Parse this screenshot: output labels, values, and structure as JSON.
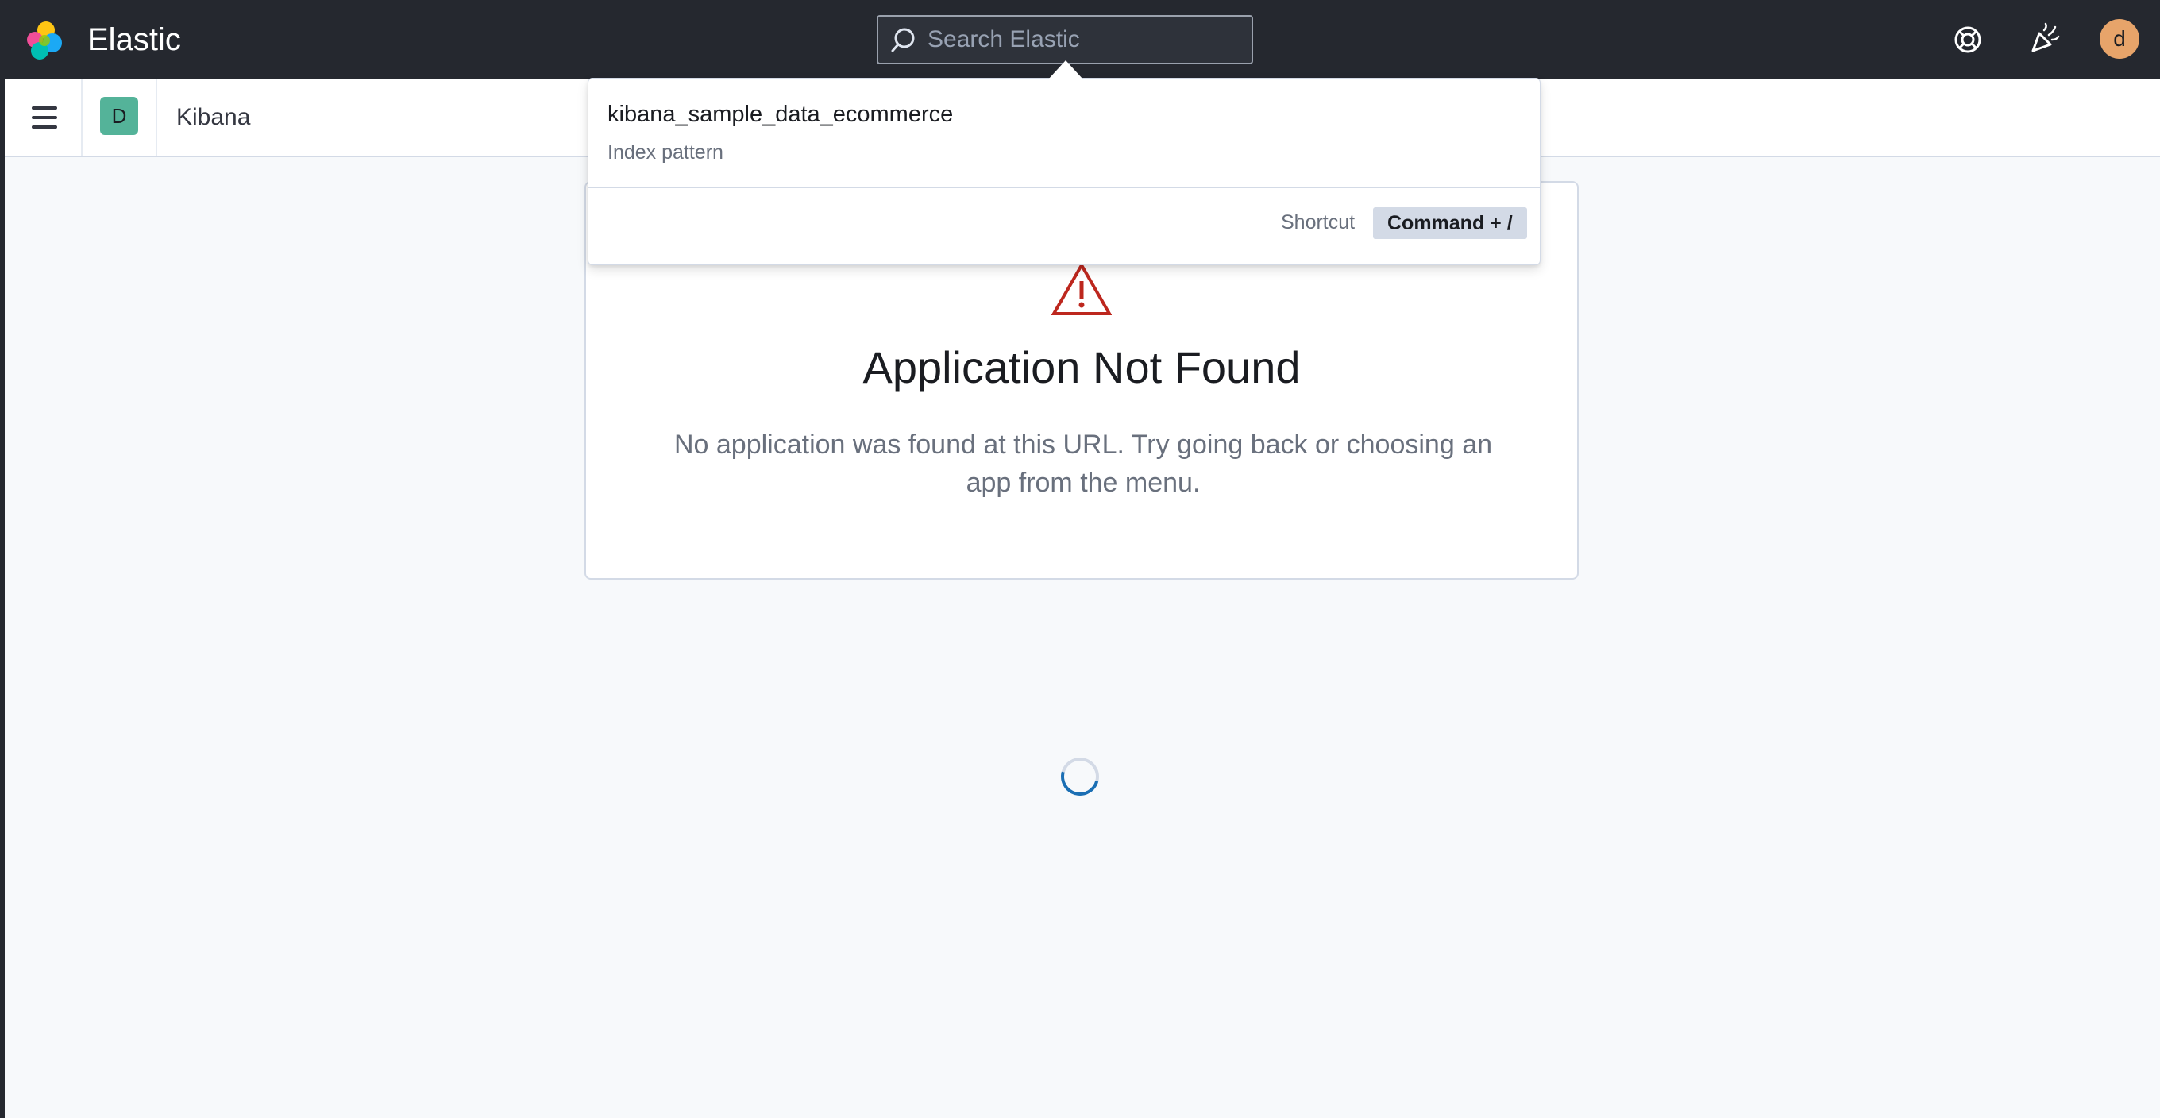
{
  "header": {
    "brand": "Elastic",
    "search_placeholder": "Search Elastic",
    "icons": [
      "help-icon",
      "newsfeed-icon"
    ],
    "user_initial": "d",
    "avatar_color": "#e7a46a"
  },
  "subheader": {
    "space_initial": "D",
    "space_color": "#54b399",
    "breadcrumb": "Kibana"
  },
  "search_results": {
    "items": [
      {
        "title": "kibana_sample_data_ecommerce",
        "meta": "Index pattern"
      }
    ],
    "shortcut_label": "Shortcut",
    "shortcut_keys": "Command + /"
  },
  "error": {
    "title": "Application Not Found",
    "description": "No application was found at this URL. Try going back or choosing an app from the menu.",
    "icon": "warning-icon",
    "icon_color": "#bd271e"
  },
  "loading": true
}
